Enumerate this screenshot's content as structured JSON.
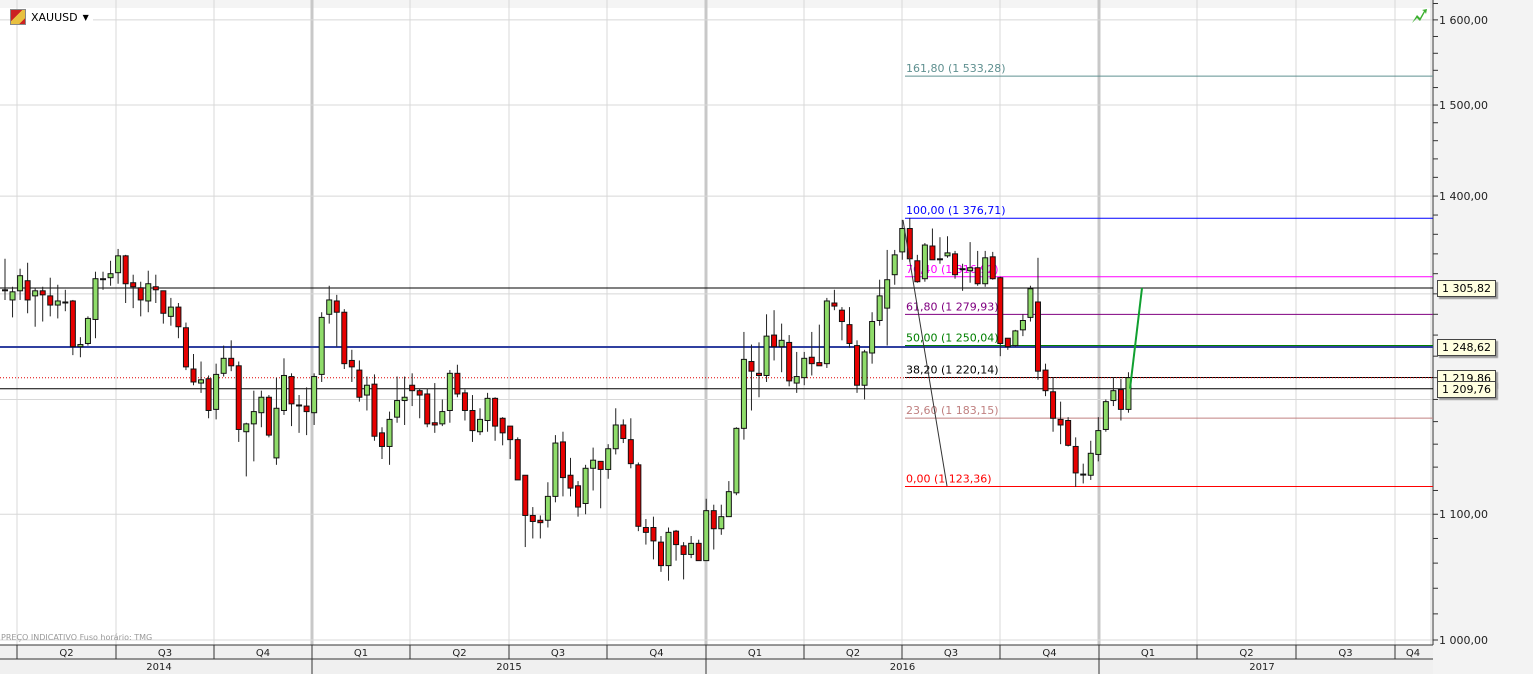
{
  "header": {
    "symbol": "XAUUSD",
    "symbol_icon": "gold-bar-icon",
    "dropdown_icon": "caret-down-icon"
  },
  "status_icon": "trend-up-icon",
  "footer_note": "PREÇO INDICATIVO   Fuso horário: TMG",
  "colors": {
    "up": "#8fdc6a",
    "down": "#e60000",
    "grid": "#d8d8d8",
    "support": "#3040a0",
    "trend": "#10a030"
  },
  "chart_data": {
    "type": "candlestick",
    "title": "XAUUSD",
    "interval": "weekly",
    "y_scale": "log",
    "ylim": [
      990,
      1650
    ],
    "grid": true,
    "y_tick_labels": [
      {
        "value": 1600,
        "label": "1 600,00"
      },
      {
        "value": 1500,
        "label": "1 500,00"
      },
      {
        "value": 1400,
        "label": "1 400,00"
      },
      {
        "value": 1100,
        "label": "1 100,00"
      },
      {
        "value": 1000,
        "label": "1 000,00"
      }
    ],
    "y_gridlines": [
      1000,
      1100,
      1200,
      1300,
      1400,
      1500,
      1600
    ],
    "x_quarters": [
      "Q2",
      "Q3",
      "Q4",
      "Q1",
      "Q2",
      "Q3",
      "Q4",
      "Q1",
      "Q2",
      "Q3",
      "Q4",
      "Q1",
      "Q2",
      "Q3",
      "Q4"
    ],
    "x_years": [
      "2014",
      "2015",
      "2016",
      "2017"
    ],
    "ohlc": [
      [
        1304,
        1335,
        1294,
        1303
      ],
      [
        1294,
        1307,
        1277,
        1302
      ],
      [
        1303,
        1325,
        1294,
        1318
      ],
      [
        1313,
        1331,
        1281,
        1294
      ],
      [
        1298,
        1306,
        1268,
        1303
      ],
      [
        1303,
        1307,
        1273,
        1299
      ],
      [
        1298,
        1316,
        1278,
        1289
      ],
      [
        1289,
        1309,
        1276,
        1293
      ],
      [
        1292,
        1304,
        1283,
        1292
      ],
      [
        1293,
        1294,
        1241,
        1249
      ],
      [
        1249,
        1258,
        1239,
        1251
      ],
      [
        1252,
        1278,
        1250,
        1276
      ],
      [
        1275,
        1322,
        1257,
        1315
      ],
      [
        1315,
        1322,
        1304,
        1315
      ],
      [
        1316,
        1333,
        1308,
        1320
      ],
      [
        1321,
        1345,
        1310,
        1338
      ],
      [
        1338,
        1339,
        1291,
        1310
      ],
      [
        1311,
        1319,
        1286,
        1307
      ],
      [
        1306,
        1312,
        1278,
        1294
      ],
      [
        1293,
        1323,
        1282,
        1310
      ],
      [
        1307,
        1319,
        1291,
        1304
      ],
      [
        1303,
        1303,
        1271,
        1281
      ],
      [
        1278,
        1296,
        1269,
        1287
      ],
      [
        1287,
        1291,
        1257,
        1268
      ],
      [
        1267,
        1272,
        1227,
        1230
      ],
      [
        1228,
        1242,
        1213,
        1216
      ],
      [
        1215,
        1235,
        1206,
        1218
      ],
      [
        1219,
        1222,
        1183,
        1190
      ],
      [
        1191,
        1233,
        1182,
        1223
      ],
      [
        1224,
        1250,
        1221,
        1238
      ],
      [
        1238,
        1255,
        1226,
        1231
      ],
      [
        1231,
        1235,
        1162,
        1173
      ],
      [
        1171,
        1179,
        1132,
        1178
      ],
      [
        1178,
        1208,
        1145,
        1189
      ],
      [
        1188,
        1208,
        1175,
        1202
      ],
      [
        1202,
        1204,
        1166,
        1168
      ],
      [
        1148,
        1220,
        1142,
        1192
      ],
      [
        1190,
        1238,
        1186,
        1222
      ],
      [
        1221,
        1224,
        1176,
        1196
      ],
      [
        1195,
        1204,
        1170,
        1195
      ],
      [
        1194,
        1211,
        1168,
        1189
      ],
      [
        1188,
        1224,
        1177,
        1221
      ],
      [
        1223,
        1282,
        1216,
        1277
      ],
      [
        1280,
        1308,
        1271,
        1294
      ],
      [
        1293,
        1299,
        1249,
        1282
      ],
      [
        1282,
        1285,
        1228,
        1233
      ],
      [
        1236,
        1246,
        1216,
        1230
      ],
      [
        1227,
        1236,
        1198,
        1202
      ],
      [
        1204,
        1221,
        1190,
        1213
      ],
      [
        1214,
        1223,
        1163,
        1167
      ],
      [
        1170,
        1175,
        1147,
        1158
      ],
      [
        1158,
        1189,
        1142,
        1182
      ],
      [
        1184,
        1221,
        1179,
        1199
      ],
      [
        1199,
        1221,
        1177,
        1202
      ],
      [
        1213,
        1224,
        1194,
        1208
      ],
      [
        1208,
        1210,
        1183,
        1204
      ],
      [
        1205,
        1210,
        1175,
        1178
      ],
      [
        1179,
        1215,
        1170,
        1177
      ],
      [
        1178,
        1200,
        1176,
        1189
      ],
      [
        1190,
        1227,
        1179,
        1224
      ],
      [
        1224,
        1232,
        1202,
        1205
      ],
      [
        1206,
        1209,
        1181,
        1190
      ],
      [
        1190,
        1204,
        1162,
        1172
      ],
      [
        1171,
        1192,
        1168,
        1182
      ],
      [
        1181,
        1206,
        1171,
        1201
      ],
      [
        1201,
        1202,
        1163,
        1176
      ],
      [
        1183,
        1184,
        1159,
        1170
      ],
      [
        1176,
        1176,
        1147,
        1164
      ],
      [
        1164,
        1166,
        1129,
        1129
      ],
      [
        1133,
        1133,
        1073,
        1099
      ],
      [
        1099,
        1106,
        1080,
        1094
      ],
      [
        1095,
        1099,
        1080,
        1093
      ],
      [
        1095,
        1127,
        1089,
        1115
      ],
      [
        1115,
        1168,
        1110,
        1161
      ],
      [
        1162,
        1171,
        1115,
        1131
      ],
      [
        1133,
        1148,
        1115,
        1122
      ],
      [
        1124,
        1128,
        1098,
        1106
      ],
      [
        1109,
        1142,
        1100,
        1139
      ],
      [
        1139,
        1157,
        1120,
        1146
      ],
      [
        1145,
        1145,
        1105,
        1138
      ],
      [
        1138,
        1160,
        1130,
        1156
      ],
      [
        1156,
        1192,
        1151,
        1177
      ],
      [
        1177,
        1182,
        1161,
        1165
      ],
      [
        1164,
        1183,
        1139,
        1143
      ],
      [
        1142,
        1144,
        1086,
        1090
      ],
      [
        1089,
        1096,
        1075,
        1085
      ],
      [
        1089,
        1098,
        1063,
        1078
      ],
      [
        1077,
        1082,
        1053,
        1058
      ],
      [
        1058,
        1089,
        1046,
        1085
      ],
      [
        1086,
        1087,
        1062,
        1075
      ],
      [
        1074,
        1077,
        1047,
        1067
      ],
      [
        1067,
        1082,
        1064,
        1076
      ],
      [
        1076,
        1079,
        1062,
        1062
      ],
      [
        1062,
        1113,
        1062,
        1103
      ],
      [
        1103,
        1108,
        1071,
        1088
      ],
      [
        1088,
        1108,
        1083,
        1098
      ],
      [
        1098,
        1128,
        1098,
        1119
      ],
      [
        1118,
        1175,
        1116,
        1174
      ],
      [
        1174,
        1263,
        1164,
        1237
      ],
      [
        1235,
        1251,
        1190,
        1226
      ],
      [
        1224,
        1253,
        1202,
        1222
      ],
      [
        1222,
        1280,
        1216,
        1259
      ],
      [
        1260,
        1284,
        1236,
        1249
      ],
      [
        1249,
        1271,
        1225,
        1255
      ],
      [
        1253,
        1260,
        1212,
        1217
      ],
      [
        1215,
        1244,
        1206,
        1221
      ],
      [
        1220,
        1244,
        1213,
        1238
      ],
      [
        1239,
        1263,
        1222,
        1233
      ],
      [
        1234,
        1270,
        1231,
        1231
      ],
      [
        1233,
        1296,
        1229,
        1293
      ],
      [
        1291,
        1304,
        1284,
        1288
      ],
      [
        1284,
        1287,
        1255,
        1273
      ],
      [
        1270,
        1287,
        1248,
        1252
      ],
      [
        1250,
        1255,
        1206,
        1213
      ],
      [
        1213,
        1246,
        1200,
        1244
      ],
      [
        1243,
        1282,
        1233,
        1273
      ],
      [
        1274,
        1314,
        1269,
        1298
      ],
      [
        1286,
        1344,
        1250,
        1314
      ],
      [
        1319,
        1344,
        1309,
        1339
      ],
      [
        1342,
        1375,
        1334,
        1366
      ],
      [
        1366,
        1377,
        1332,
        1335
      ],
      [
        1333,
        1339,
        1311,
        1312
      ],
      [
        1315,
        1351,
        1312,
        1349
      ],
      [
        1348,
        1366,
        1334,
        1334
      ],
      [
        1335,
        1357,
        1330,
        1335
      ],
      [
        1338,
        1358,
        1336,
        1341
      ],
      [
        1340,
        1343,
        1315,
        1319
      ],
      [
        1325,
        1330,
        1303,
        1325
      ],
      [
        1323,
        1352,
        1311,
        1326
      ],
      [
        1326,
        1343,
        1308,
        1310
      ],
      [
        1310,
        1343,
        1307,
        1336
      ],
      [
        1337,
        1342,
        1314,
        1315
      ],
      [
        1316,
        1317,
        1240,
        1252
      ],
      [
        1257,
        1257,
        1246,
        1249
      ],
      [
        1250,
        1265,
        1249,
        1264
      ],
      [
        1265,
        1280,
        1259,
        1274
      ],
      [
        1277,
        1308,
        1273,
        1305
      ],
      [
        1292,
        1336,
        1218,
        1226
      ],
      [
        1227,
        1233,
        1203,
        1208
      ],
      [
        1207,
        1220,
        1171,
        1183
      ],
      [
        1182,
        1198,
        1160,
        1177
      ],
      [
        1181,
        1184,
        1158,
        1159
      ],
      [
        1158,
        1166,
        1123,
        1135
      ],
      [
        1134,
        1143,
        1126,
        1134
      ],
      [
        1133,
        1163,
        1129,
        1152
      ],
      [
        1151,
        1184,
        1145,
        1172
      ],
      [
        1173,
        1200,
        1171,
        1198
      ],
      [
        1199,
        1220,
        1194,
        1208
      ],
      [
        1209,
        1219,
        1181,
        1191
      ],
      [
        1191,
        1225,
        1188,
        1220
      ]
    ],
    "fibonacci": [
      {
        "label": "161,80 (1 533,28)",
        "price": 1533.28,
        "color": "#5f9090"
      },
      {
        "label": "100,00 (1 376,71)",
        "price": 1376.71,
        "color": "#0000ff"
      },
      {
        "label": "76,40 (1 316,92)",
        "price": 1316.92,
        "color": "#ff00ff"
      },
      {
        "label": "61,80 (1 279,93)",
        "price": 1279.93,
        "color": "#800080"
      },
      {
        "label": "50,00 (1 250,04)",
        "price": 1250.04,
        "color": "#008000"
      },
      {
        "label": "38,20 (1 220,14)",
        "price": 1220.14,
        "color": "#000000"
      },
      {
        "label": "23,60 (1 183,15)",
        "price": 1183.15,
        "color": "#c08080"
      },
      {
        "label": "0,00 (1 123,36)",
        "price": 1123.36,
        "color": "#ff0000"
      }
    ],
    "horizontal_lines": [
      {
        "label": "1 305,82",
        "price": 1305.82,
        "color": "#000000",
        "style": "solid"
      },
      {
        "label": "1 248,62",
        "price": 1248.62,
        "color": "#3040a0",
        "style": "thick"
      },
      {
        "label": "1 219,86",
        "price": 1219.86,
        "color": "#e00000",
        "style": "dotted"
      },
      {
        "label": "1 209,76",
        "price": 1209.76,
        "color": "#000000",
        "style": "solid"
      }
    ],
    "trend_line": {
      "from_price": 1209.76,
      "to_price": 1305.82,
      "color": "#10a030"
    }
  }
}
